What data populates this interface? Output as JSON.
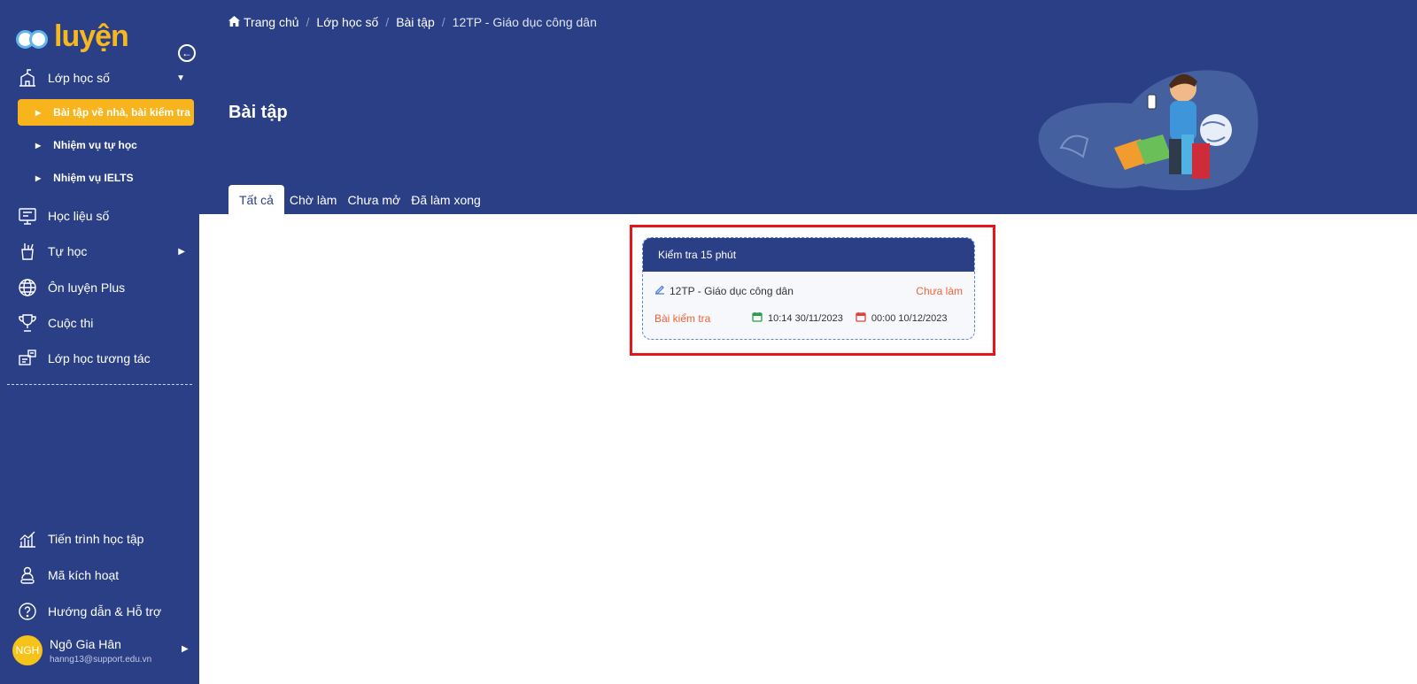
{
  "brand": {
    "logo_part1": "ôn",
    "logo_part2": "luyện"
  },
  "sidebar": {
    "items": [
      {
        "label": "Lớp học số"
      },
      {
        "label": "Học liệu số"
      },
      {
        "label": "Tự học"
      },
      {
        "label": "Ôn luyện Plus"
      },
      {
        "label": "Cuộc thi"
      },
      {
        "label": "Lớp học tương tác"
      }
    ],
    "subitems": [
      {
        "label": "Bài tập về nhà, bài kiểm tra"
      },
      {
        "label": "Nhiệm vụ tự học"
      },
      {
        "label": "Nhiệm vụ IELTS"
      }
    ],
    "bottom_items": [
      {
        "label": "Tiến trình học tập"
      },
      {
        "label": "Mã kích hoạt"
      },
      {
        "label": "Hướng dẫn & Hỗ trợ"
      }
    ],
    "user": {
      "initials": "NGH",
      "name": "Ngô Gia Hân",
      "email": "hanng13@support.edu.vn"
    }
  },
  "breadcrumb": {
    "home": "Trang chủ",
    "items": [
      "Lớp học số",
      "Bài tập",
      "12TP - Giáo dục công dân"
    ]
  },
  "page_title": "Bài tập",
  "tabs": [
    {
      "label": "Tất cả"
    },
    {
      "label": "Chờ làm"
    },
    {
      "label": "Chưa mở"
    },
    {
      "label": "Đã làm xong"
    }
  ],
  "card": {
    "title": "Kiểm tra 15 phút",
    "class_name": "12TP - Giáo dục công dân",
    "status": "Chưa làm",
    "kind": "Bài kiểm tra",
    "start": "10:14 30/11/2023",
    "end": "00:00 10/12/2023"
  },
  "colors": {
    "primary": "#2b3f86",
    "accent": "#f8b41c",
    "status": "#f0623a",
    "highlight": "#e8141b"
  }
}
